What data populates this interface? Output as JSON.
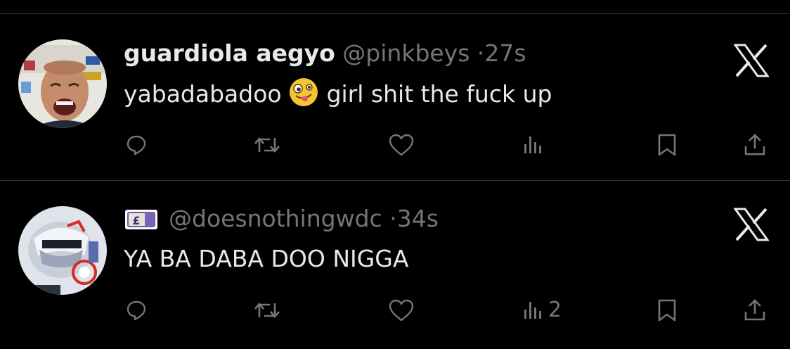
{
  "tweets": [
    {
      "display_name": "guardiola aegyo",
      "handle": "@pinkbeys",
      "separator": "·",
      "time": "27s",
      "text_before_emoji": "yabadabadoo",
      "emoji": "zany-face-emoji",
      "text_after_emoji": "girl shit the fuck up",
      "actions": {
        "reply": {
          "icon": "reply-icon",
          "count": ""
        },
        "repost": {
          "icon": "repost-icon",
          "count": ""
        },
        "like": {
          "icon": "heart-icon",
          "count": ""
        },
        "views": {
          "icon": "views-icon",
          "count": ""
        },
        "bookmark": {
          "icon": "bookmark-icon",
          "count": ""
        },
        "share": {
          "icon": "share-icon",
          "count": ""
        }
      }
    },
    {
      "display_name_emoji": "pound-banknote-emoji",
      "handle": "@doesnothingwdc",
      "separator": "·",
      "time": "34s",
      "text": "YA BA DABA DOO NIGGA",
      "actions": {
        "reply": {
          "icon": "reply-icon",
          "count": ""
        },
        "repost": {
          "icon": "repost-icon",
          "count": ""
        },
        "like": {
          "icon": "heart-icon",
          "count": ""
        },
        "views": {
          "icon": "views-icon",
          "count": "2"
        },
        "bookmark": {
          "icon": "bookmark-icon",
          "count": ""
        },
        "share": {
          "icon": "share-icon",
          "count": ""
        }
      }
    }
  ],
  "colors": {
    "background": "#000000",
    "primary_text": "#e7e9ea",
    "secondary_text": "#71767b",
    "divider": "#2f3336"
  }
}
